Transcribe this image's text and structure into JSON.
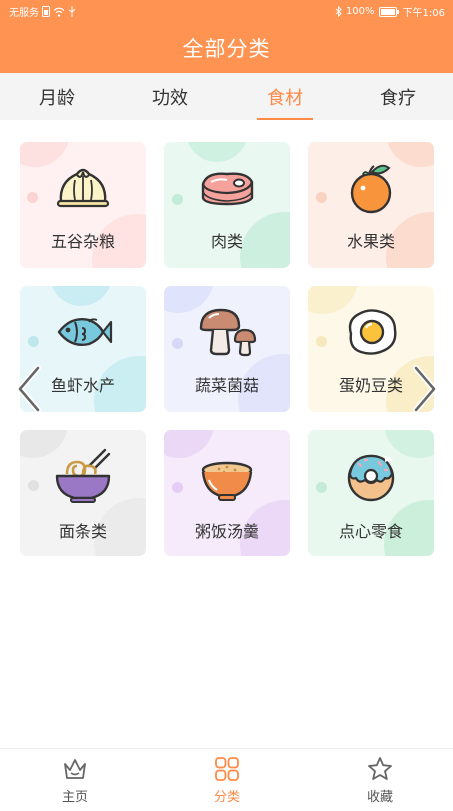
{
  "status_bar": {
    "carrier": "无服务",
    "battery": "100%",
    "time": "下午1:06"
  },
  "header": {
    "title": "全部分类"
  },
  "tabs": [
    {
      "label": "月龄",
      "active": false
    },
    {
      "label": "功效",
      "active": false
    },
    {
      "label": "食材",
      "active": true
    },
    {
      "label": "食疗",
      "active": false
    }
  ],
  "categories": [
    {
      "label": "五谷杂粮",
      "icon": "steamed-bun-icon"
    },
    {
      "label": "肉类",
      "icon": "meat-icon"
    },
    {
      "label": "水果类",
      "icon": "orange-icon"
    },
    {
      "label": "鱼虾水产",
      "icon": "fish-icon"
    },
    {
      "label": "蔬菜菌菇",
      "icon": "mushroom-icon"
    },
    {
      "label": "蛋奶豆类",
      "icon": "fried-egg-icon"
    },
    {
      "label": "面条类",
      "icon": "noodle-bowl-icon"
    },
    {
      "label": "粥饭汤羹",
      "icon": "soup-bowl-icon"
    },
    {
      "label": "点心零食",
      "icon": "donut-icon"
    }
  ],
  "bottom_nav": [
    {
      "label": "主页",
      "icon": "home-crown-icon",
      "active": false
    },
    {
      "label": "分类",
      "icon": "category-grid-icon",
      "active": true
    },
    {
      "label": "收藏",
      "icon": "star-icon",
      "active": false
    }
  ],
  "colors": {
    "brand": "#fe9352",
    "active": "#fe8a45"
  }
}
